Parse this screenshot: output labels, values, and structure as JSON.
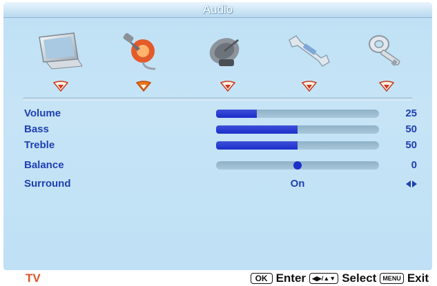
{
  "title": "Audio",
  "menu_icons": [
    {
      "name": "picture-tab-icon"
    },
    {
      "name": "audio-tab-icon"
    },
    {
      "name": "tv-tab-icon"
    },
    {
      "name": "setup-tab-icon"
    },
    {
      "name": "parental-tab-icon"
    }
  ],
  "selected_tab": 1,
  "rows": {
    "volume": {
      "label": "Volume",
      "value": "25",
      "level": 0.25
    },
    "bass": {
      "label": "Bass",
      "value": "50",
      "level": 0.5
    },
    "treble": {
      "label": "Treble",
      "value": "50",
      "level": 0.5
    },
    "balance": {
      "label": "Balance",
      "value": "0",
      "level": 0.5
    },
    "surround": {
      "label": "Surround",
      "value": "On"
    }
  },
  "footer": {
    "source": "TV",
    "ok_key": "OK",
    "enter_label": "Enter",
    "select_label": "Select",
    "menu_key": "MENU",
    "exit_label": "Exit"
  },
  "colors": {
    "label": "#1e3fb2",
    "bar_fill": "#1b2fc9",
    "source": "#e0522a",
    "marker_selected": "#e8751a",
    "marker": "#c83a20"
  }
}
